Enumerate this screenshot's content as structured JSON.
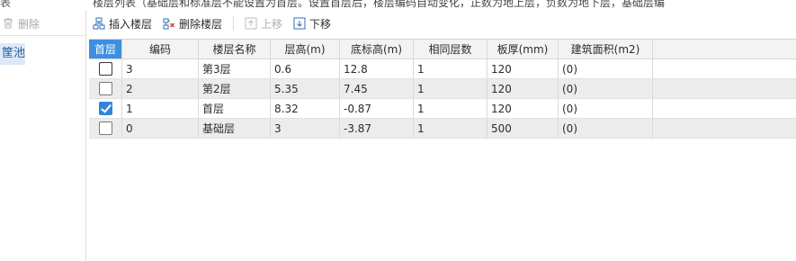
{
  "top": {
    "left_clip": "表",
    "hint": "楼层列表（基础层和标准层不能设置为首层。设置首层后，楼层编码自动变化，正数为地上层，负数为地下层，基础层编"
  },
  "left_panel": {
    "delete_label": "删除",
    "selected_item": "筐池"
  },
  "toolbar": {
    "insert_label": "插入楼层",
    "delete_label": "删除楼层",
    "move_up_label": "上移",
    "move_down_label": "下移"
  },
  "table": {
    "headers": [
      "首层",
      "编码",
      "楼层名称",
      "层高(m)",
      "底标高(m)",
      "相同层数",
      "板厚(mm)",
      "建筑面积(m2)",
      ""
    ],
    "rows": [
      {
        "first": false,
        "code": "3",
        "name": "第3层",
        "height": "0.6",
        "bottom": "12.8",
        "same": "1",
        "thick": "120",
        "area": "(0)"
      },
      {
        "first": false,
        "code": "2",
        "name": "第2层",
        "height": "5.35",
        "bottom": "7.45",
        "same": "1",
        "thick": "120",
        "area": "(0)"
      },
      {
        "first": true,
        "code": "1",
        "name": "首层",
        "height": "8.32",
        "bottom": "-0.87",
        "same": "1",
        "thick": "120",
        "area": "(0)"
      },
      {
        "first": false,
        "code": "0",
        "name": "基础层",
        "height": "3",
        "bottom": "-3.87",
        "same": "1",
        "thick": "500",
        "area": "(0)"
      }
    ]
  },
  "colors": {
    "accent": "#3f8fe0",
    "checkbox_checked": "#2f86d8",
    "row_alt": "#ececec",
    "left_selected": "#dce9f7"
  }
}
